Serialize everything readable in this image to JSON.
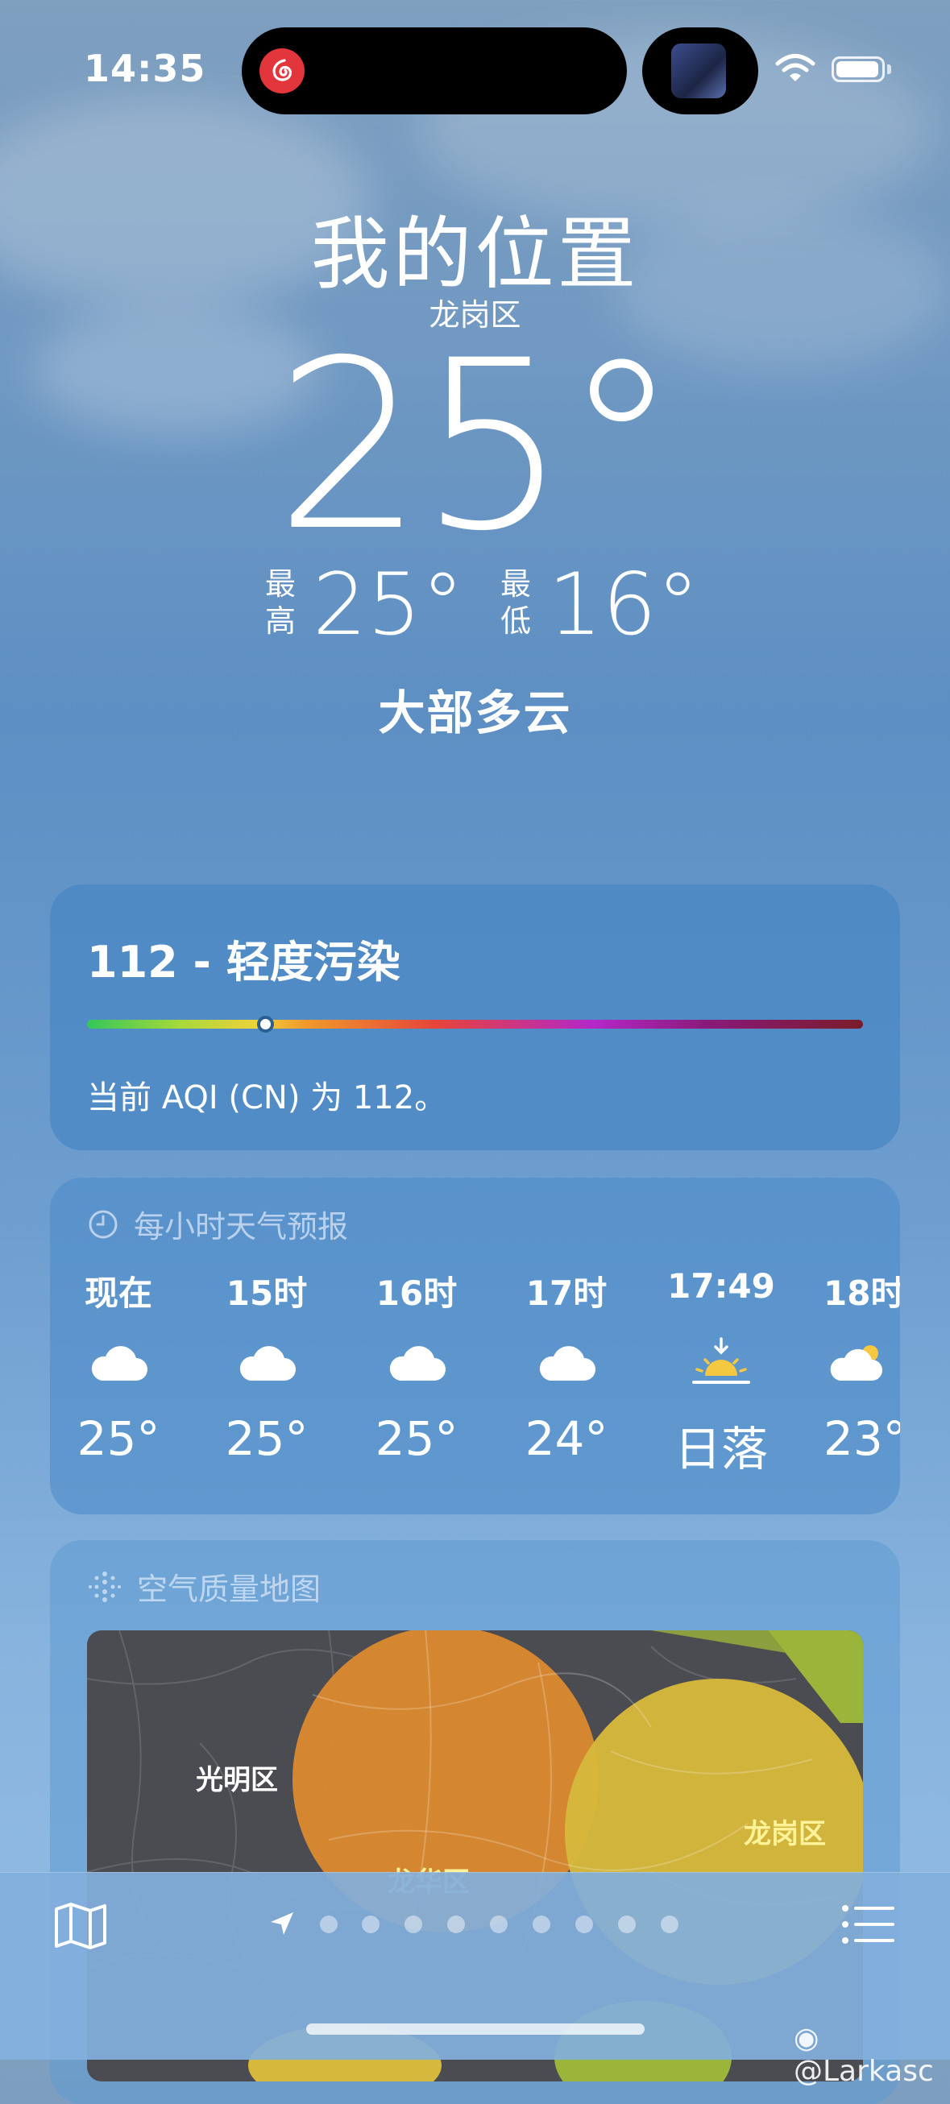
{
  "status_bar": {
    "time": "14:35"
  },
  "location": {
    "title": "我的位置",
    "district": "龙岗区"
  },
  "current": {
    "temperature": "25°",
    "high_label_1": "最",
    "high_label_2": "高",
    "high": "25°",
    "low_label_1": "最",
    "low_label_2": "低",
    "low": "16°",
    "condition": "大部多云"
  },
  "aqi": {
    "title": "112 - 轻度污染",
    "description": "当前 AQI (CN) 为 112。",
    "level": 0.23
  },
  "hourly": {
    "header": "每小时天气预报",
    "items": [
      {
        "time": "现在",
        "icon": "cloud-icon",
        "temp": "25°"
      },
      {
        "time": "15时",
        "icon": "cloud-icon",
        "temp": "25°"
      },
      {
        "time": "16时",
        "icon": "cloud-icon",
        "temp": "25°"
      },
      {
        "time": "17时",
        "icon": "cloud-icon",
        "temp": "24°"
      },
      {
        "time": "17:49",
        "icon": "sunset-icon",
        "temp": "日落"
      },
      {
        "time": "18时",
        "icon": "cloud-sun-icon",
        "temp": "23°"
      }
    ]
  },
  "air_map": {
    "header": "空气质量地图",
    "labels": {
      "guangming": "光明区",
      "longgang": "龙岗区",
      "longhua": "龙华区"
    }
  },
  "watermark": "@Larkasc",
  "colors": {
    "aqi_orange": "#d98a2e",
    "aqi_yellow": "#d9b93a",
    "aqi_green": "#9bb43a",
    "map_base": "#4a4c52"
  }
}
